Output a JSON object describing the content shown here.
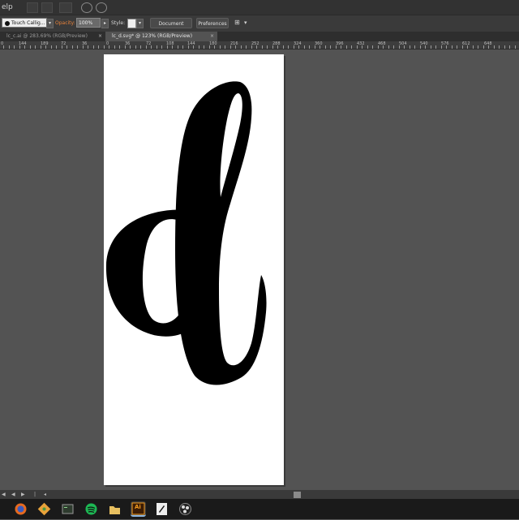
{
  "menubar": {
    "help_label": "elp"
  },
  "control_bar": {
    "brush_name": "Touch Callig...",
    "opacity_label": "Opacity:",
    "opacity_value": "100%",
    "style_label": "Style:",
    "document_setup_label": "Document Setup",
    "preferences_label": "Preferences"
  },
  "tabs": [
    {
      "label": "lc_c.ai @ 283.69% (RGB/Preview)",
      "active": false
    },
    {
      "label": "lc_d.svg* @ 123% (RGB/Preview)",
      "active": true
    }
  ],
  "ruler": {
    "labels": [
      "0",
      "144",
      "189",
      "72",
      "36",
      "0",
      "36",
      "72",
      "108",
      "144",
      "180",
      "216",
      "252",
      "288",
      "324",
      "360",
      "396",
      "432",
      "468",
      "504",
      "540",
      "576",
      "612",
      "648"
    ]
  },
  "colors": {
    "opacity_label": "#e8823a",
    "artboard": "#ffffff",
    "canvas": "#535353",
    "glyph": "#000000"
  },
  "taskbar": {
    "apps": [
      "firefox-icon",
      "git-icon",
      "terminal-icon",
      "spotify-icon",
      "file-manager-icon",
      "illustrator-icon",
      "inkscape-icon",
      "obs-icon"
    ],
    "illustrator_label": "Ai"
  }
}
